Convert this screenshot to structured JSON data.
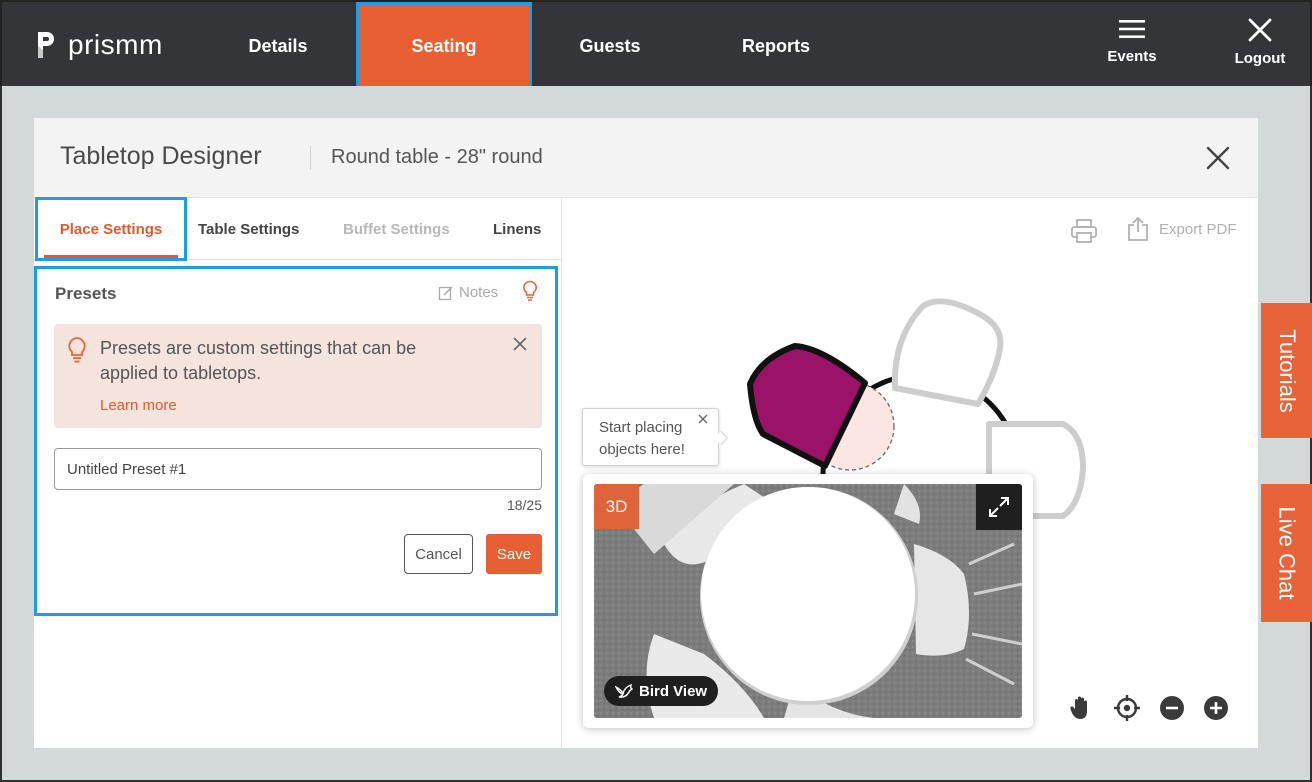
{
  "app": {
    "logo_text": "prismm"
  },
  "nav": {
    "items": [
      {
        "label": "Details"
      },
      {
        "label": "Seating"
      },
      {
        "label": "Guests"
      },
      {
        "label": "Reports"
      }
    ],
    "events_label": "Events",
    "logout_label": "Logout",
    "active_color": "#e85f35"
  },
  "modal": {
    "title": "Tabletop Designer",
    "subtitle": "Round table - 28\" round"
  },
  "tabs": [
    {
      "label": "Place Settings",
      "state": "active"
    },
    {
      "label": "Table Settings",
      "state": "normal"
    },
    {
      "label": "Buffet Settings",
      "state": "disabled"
    },
    {
      "label": "Linens",
      "state": "normal"
    }
  ],
  "presets": {
    "title": "Presets",
    "notes_label": "Notes",
    "info_text": "Presets are custom settings that can be applied to tabletops.",
    "learn_more": "Learn more",
    "input_value": "Untitled Preset #1",
    "char_count": "18/25",
    "cancel_label": "Cancel",
    "save_label": "Save"
  },
  "canvas": {
    "export_label": "Export PDF",
    "tooltip_text": "Start placing objects here!",
    "badge_3d": "3D",
    "bird_view_label": "Bird View",
    "selected_chair_color": "#9b1368"
  },
  "side_tabs": {
    "tutorials": "Tutorials",
    "live_chat": "Live Chat"
  },
  "icons": [
    "menu-icon",
    "close-icon",
    "notes-icon",
    "lightbulb-icon",
    "print-icon",
    "export-icon",
    "expand-icon",
    "bird-icon",
    "hand-icon",
    "crosshair-icon",
    "zoom-out-icon",
    "zoom-in-icon"
  ]
}
